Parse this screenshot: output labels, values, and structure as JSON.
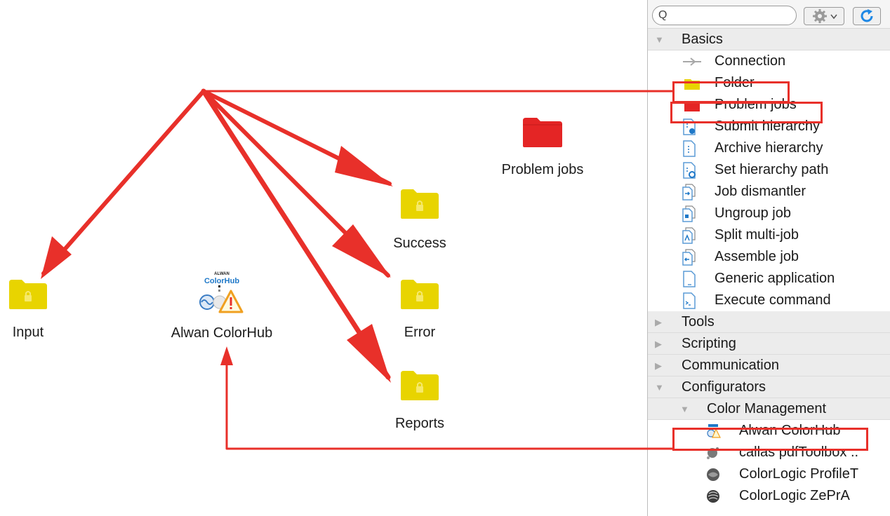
{
  "canvas": {
    "nodes": {
      "input": "Input",
      "colorhub": "Alwan ColorHub",
      "colorhub_logo_top": "ALWAN",
      "colorhub_logo_main": "ColorHub",
      "success": "Success",
      "error": "Error",
      "reports": "Reports",
      "problem_jobs": "Problem jobs"
    }
  },
  "panel": {
    "search_placeholder": "Q",
    "categories": {
      "basics": "Basics",
      "tools": "Tools",
      "scripting": "Scripting",
      "communication": "Communication",
      "configurators": "Configurators",
      "color_management": "Color Management"
    },
    "basics_items": [
      {
        "label": "Connection",
        "icon": "connection-icon"
      },
      {
        "label": "Folder",
        "icon": "folder-icon"
      },
      {
        "label": "Problem jobs",
        "icon": "problem-folder-icon"
      },
      {
        "label": "Submit hierarchy",
        "icon": "submit-hierarchy-icon"
      },
      {
        "label": "Archive hierarchy",
        "icon": "archive-hierarchy-icon"
      },
      {
        "label": "Set hierarchy path",
        "icon": "set-hierarchy-path-icon"
      },
      {
        "label": "Job dismantler",
        "icon": "job-dismantler-icon"
      },
      {
        "label": "Ungroup job",
        "icon": "ungroup-job-icon"
      },
      {
        "label": "Split multi-job",
        "icon": "split-multi-job-icon"
      },
      {
        "label": "Assemble job",
        "icon": "assemble-job-icon"
      },
      {
        "label": "Generic application",
        "icon": "generic-application-icon"
      },
      {
        "label": "Execute command",
        "icon": "execute-command-icon"
      }
    ],
    "color_items": [
      {
        "label": "Alwan ColorHub",
        "icon": "alwan-colorhub-icon"
      },
      {
        "label": "callas pdfToolbox ..",
        "icon": "callas-icon"
      },
      {
        "label": "ColorLogic ProfileT",
        "icon": "colorlogic-profile-icon"
      },
      {
        "label": "ColorLogic ZePrA",
        "icon": "colorlogic-zepra-icon"
      }
    ]
  },
  "colors": {
    "annotation_red": "#e8302a",
    "folder_yellow": "#e8d400",
    "problem_folder_red": "#e42525",
    "category_bg": "#ececec"
  }
}
